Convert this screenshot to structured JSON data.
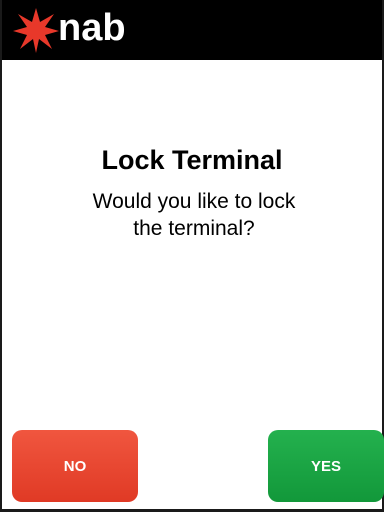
{
  "header": {
    "logo_text": "nab",
    "background_color": "#000000",
    "logo_star_color": "#e8382a"
  },
  "dialog": {
    "title": "Lock Terminal",
    "message_line1": "Would you like to lock",
    "message_line2": "the terminal?"
  },
  "buttons": {
    "no_label": "NO",
    "yes_label": "YES",
    "no_color": "#e8402b",
    "yes_color": "#1aa444"
  }
}
